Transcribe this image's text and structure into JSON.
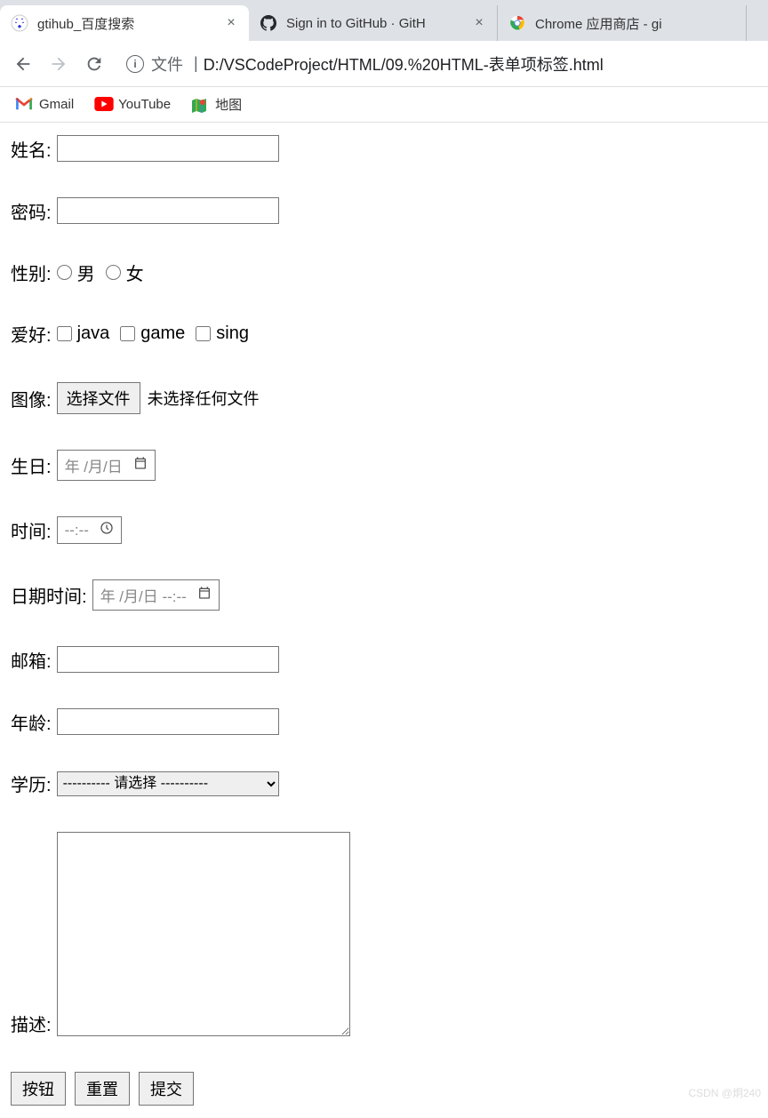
{
  "tabs": [
    {
      "title": "gtihub_百度搜索",
      "icon": "baidu"
    },
    {
      "title": "Sign in to GitHub · GitH",
      "icon": "github"
    },
    {
      "title": "Chrome 应用商店 - gi",
      "icon": "chrome"
    }
  ],
  "url": {
    "prefix": "文件",
    "path": "D:/VSCodeProject/HTML/09.%20HTML-表单项标签.html"
  },
  "bookmarks": [
    {
      "label": "Gmail",
      "icon": "gmail"
    },
    {
      "label": "YouTube",
      "icon": "youtube"
    },
    {
      "label": "地图",
      "icon": "maps"
    }
  ],
  "form": {
    "name_label": "姓名:",
    "password_label": "密码:",
    "gender_label": "性别:",
    "gender_male": "男",
    "gender_female": "女",
    "hobby_label": "爱好:",
    "hobby_java": "java",
    "hobby_game": "game",
    "hobby_sing": "sing",
    "image_label": "图像:",
    "file_button": "选择文件",
    "file_status": "未选择任何文件",
    "birthday_label": "生日:",
    "birthday_placeholder": "年 /月/日",
    "time_label": "时间:",
    "time_placeholder": "--:--",
    "datetime_label": "日期时间:",
    "datetime_placeholder": "年 /月/日 --:--",
    "email_label": "邮箱:",
    "age_label": "年龄:",
    "education_label": "学历:",
    "education_placeholder": "---------- 请选择 ----------",
    "description_label": "描述:",
    "button_label": "按钮",
    "reset_label": "重置",
    "submit_label": "提交"
  },
  "watermark": "CSDN @炯240"
}
